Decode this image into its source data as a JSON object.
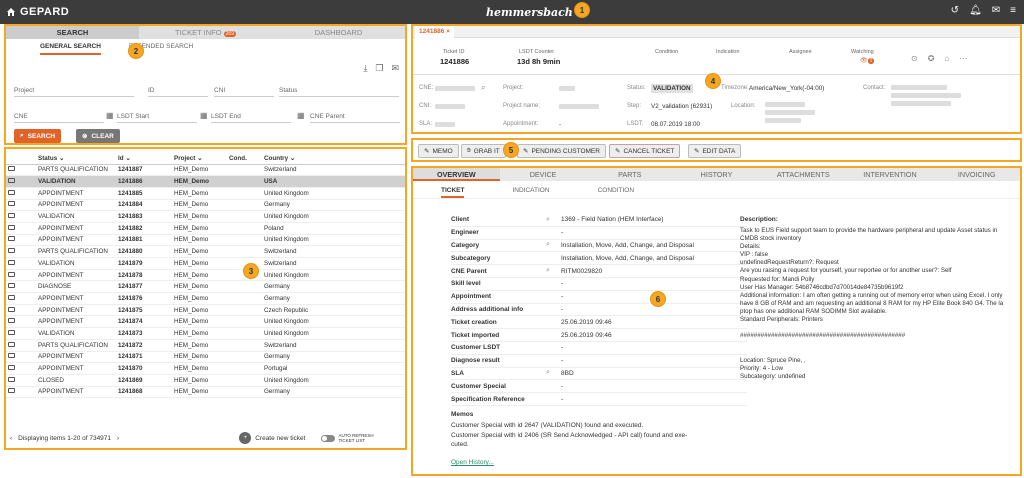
{
  "app": {
    "name": "GEPARD",
    "brand": "hemmersbach"
  },
  "badges": [
    "1",
    "2",
    "3",
    "4",
    "5",
    "6"
  ],
  "search": {
    "tabs": [
      {
        "label": "SEARCH"
      },
      {
        "label": "TICKET INFO"
      },
      {
        "label": "DASHBOARD"
      }
    ],
    "ticket_info_badge": "269",
    "subtabs": [
      {
        "label": "GENERAL SEARCH"
      },
      {
        "label": "EXTENDED SEARCH"
      }
    ],
    "fields": {
      "project": "Project",
      "id": "ID",
      "cni": "CNI",
      "status": "Status",
      "cne": "CNE",
      "lsdt_start": "LSDT Start",
      "lsdt_end": "LSDT End",
      "cne_parent": "CNE Parent"
    },
    "search_btn": "SEARCH",
    "clear_btn": "CLEAR"
  },
  "grid": {
    "columns": [
      "Status",
      "Id",
      "Project",
      "Cond.",
      "Country"
    ],
    "rows": [
      {
        "status": "PARTS QUALIFICATION",
        "id": "1241887",
        "project": "HEM_Demo",
        "country": "Switzerland"
      },
      {
        "status": "VALIDATION",
        "id": "1241886",
        "project": "HEM_Demo",
        "country": "USA"
      },
      {
        "status": "APPOINTMENT",
        "id": "1241885",
        "project": "HEM_Demo",
        "country": "United Kingdom"
      },
      {
        "status": "APPOINTMENT",
        "id": "1241884",
        "project": "HEM_Demo",
        "country": "Germany"
      },
      {
        "status": "VALIDATION",
        "id": "1241883",
        "project": "HEM_Demo",
        "country": "United Kingdom"
      },
      {
        "status": "APPOINTMENT",
        "id": "1241882",
        "project": "HEM_Demo",
        "country": "Poland"
      },
      {
        "status": "APPOINTMENT",
        "id": "1241881",
        "project": "HEM_Demo",
        "country": "United Kingdom"
      },
      {
        "status": "PARTS QUALIFICATION",
        "id": "1241880",
        "project": "HEM_Demo",
        "country": "Switzerland"
      },
      {
        "status": "VALIDATION",
        "id": "1241879",
        "project": "HEM_Demo",
        "country": "Switzerland"
      },
      {
        "status": "APPOINTMENT",
        "id": "1241878",
        "project": "HEM_Demo",
        "country": "United Kingdom"
      },
      {
        "status": "DIAGNOSE",
        "id": "1241877",
        "project": "HEM_Demo",
        "country": "Germany"
      },
      {
        "status": "APPOINTMENT",
        "id": "1241876",
        "project": "HEM_Demo",
        "country": "Germany"
      },
      {
        "status": "APPOINTMENT",
        "id": "1241875",
        "project": "HEM_Demo",
        "country": "Czech Republic"
      },
      {
        "status": "APPOINTMENT",
        "id": "1241874",
        "project": "HEM_Demo",
        "country": "United Kingdom"
      },
      {
        "status": "VALIDATION",
        "id": "1241873",
        "project": "HEM_Demo",
        "country": "United Kingdom"
      },
      {
        "status": "PARTS QUALIFICATION",
        "id": "1241872",
        "project": "HEM_Demo",
        "country": "Switzerland"
      },
      {
        "status": "APPOINTMENT",
        "id": "1241871",
        "project": "HEM_Demo",
        "country": "Germany"
      },
      {
        "status": "APPOINTMENT",
        "id": "1241870",
        "project": "HEM_Demo",
        "country": "Portugal"
      },
      {
        "status": "CLOSED",
        "id": "1241869",
        "project": "HEM_Demo",
        "country": "United Kingdom"
      },
      {
        "status": "APPOINTMENT",
        "id": "1241868",
        "project": "HEM_Demo",
        "country": "Germany"
      }
    ],
    "footer": "Displaying items 1-20 of 734971",
    "create": "Create new ticket",
    "auto_refresh": "AUTO REFRESH TICKET LIST"
  },
  "ticket": {
    "tab": "1241886",
    "summary": {
      "ticket_id_label": "Ticket ID",
      "ticket_id": "1241886",
      "lsdt_label": "LSDT Counter",
      "lsdt": "13d 8h 9min",
      "condition_label": "Condition",
      "indication_label": "Indication",
      "assignee_label": "Assignee",
      "watching_label": "Watching",
      "watching_count": "1"
    },
    "info": {
      "cne": "CNE:",
      "cni": "CNI:",
      "sla": "SLA:",
      "project": "Project:",
      "project_name": "Project name:",
      "appointment": "Appointment:",
      "appointment_val": "-",
      "status": "Status:",
      "status_val": "VALIDATION",
      "step": "Step:",
      "step_val": "V2_validation (62931)",
      "lsdt": "LSDT:",
      "lsdt_val": "08.07.2019 18:00",
      "timezone": "Timezone:",
      "timezone_val": "America/New_York(-04:00)",
      "location": "Location:",
      "contact": "Contact:"
    }
  },
  "actions": [
    {
      "label": "MEMO"
    },
    {
      "label": "GRAB IT"
    },
    {
      "label": "PENDING CUSTOMER"
    },
    {
      "label": "CANCEL TICKET"
    },
    {
      "label": "EDIT DATA"
    }
  ],
  "overview": {
    "tabs": [
      "OVERVIEW",
      "DEVICE",
      "PARTS",
      "HISTORY",
      "ATTACHMENTS",
      "INTERVENTION",
      "INVOICING"
    ],
    "subtabs": [
      "TICKET",
      "INDICATION",
      "CONDITION"
    ],
    "rows": [
      {
        "label": "Client",
        "value": "1369 - Field Nation (HEM Interface)",
        "icon": true
      },
      {
        "label": "Engineer",
        "value": "-",
        "icon": false
      },
      {
        "label": "Category",
        "value": "Installation, Move, Add, Change, and Disposal",
        "icon": true
      },
      {
        "label": "Subcategory",
        "value": "Installation, Move, Add, Change, and Disposal",
        "icon": false
      },
      {
        "label": "CNE Parent",
        "value": "RITM0029820",
        "icon": true
      },
      {
        "label": "Skill level",
        "value": "-",
        "icon": false
      },
      {
        "label": "Appointment",
        "value": "-",
        "icon": false
      },
      {
        "label": "Address additional info",
        "value": "-",
        "icon": false
      },
      {
        "label": "Ticket creation",
        "value": "25.06.2019 09:46",
        "icon": false
      },
      {
        "label": "Ticket imported",
        "value": "25.06.2019 09:46",
        "icon": false
      },
      {
        "label": "Customer LSDT",
        "value": "-",
        "icon": false
      },
      {
        "label": "Diagnose result",
        "value": "-",
        "icon": false
      },
      {
        "label": "SLA",
        "value": "8BD",
        "icon": true
      },
      {
        "label": "Customer Special",
        "value": "-",
        "icon": false
      },
      {
        "label": "Specification Reference",
        "value": "-",
        "icon": false
      }
    ],
    "memos_label": "Memos",
    "memo1": "Customer Special with id 2647 (VALIDATION) found and executed.",
    "memo2": "Customer Special with id 2406 (SR Send Acknowledged - API call) found and exe-",
    "memo2b": "cuted.",
    "open_history": "Open History...",
    "description_label": "Description:",
    "description": "Task to EUS Field support team to provide the hardware peripheral and update Asset status in\nCMDB stock inventory\nDetails:\nVIP : false\nundefinedRequestReturn?: Request\nAre you raising a request for yourself, your reportee or for another user?: Self\nRequested for: Mandi Polly\nUser Has Manager: 54b8746cdbd7d70014de84735b9619f2\nAdditional information: I am often getting a running out of memory error when using Excel. I only\nhave 8 GB of RAM and am requesting an additional 8 RAM for my HP Elite Book 840 G4. The la\nptop has one additional RAM SODIMM Slot available.\nStandard Peripherals: Printers\n\n################################################\n\n\nLocation: Spruce Pine, ,\nPriority: 4 - Low\nSubcategory: undefined"
  }
}
